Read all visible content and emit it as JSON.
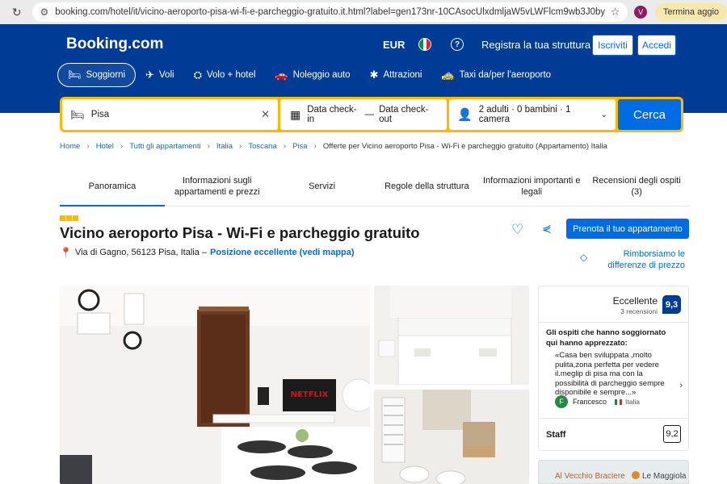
{
  "browser": {
    "url": "booking.com/hotel/it/vicino-aeroporto-pisa-wi-fi-e-parcheggio-gratuito.it.html?label=gen173nr-10CAsocUlxdmljaW5vLWFlcm9wb3J0by1waXNhLXdp",
    "profile_initial": "V",
    "update_label": "Termina aggio"
  },
  "header": {
    "logo": "Booking.com",
    "currency": "EUR",
    "register_label": "Registra la tua struttura",
    "signup_label": "Iscriviti",
    "login_label": "Accedi",
    "nav": [
      {
        "label": "Soggiorni",
        "icon": "bed-icon",
        "active": true
      },
      {
        "label": "Voli",
        "icon": "plane-icon"
      },
      {
        "label": "Volo + hotel",
        "icon": "flight-hotel-icon"
      },
      {
        "label": "Noleggio auto",
        "icon": "car-icon"
      },
      {
        "label": "Attrazioni",
        "icon": "attractions-icon"
      },
      {
        "label": "Taxi da/per l'aeroporto",
        "icon": "taxi-icon"
      }
    ]
  },
  "search": {
    "destination": "Pisa",
    "checkin": "Data check-in",
    "dash": "—",
    "checkout": "Data check-out",
    "guests": "2 adulti · 0 bambini · 1 camera",
    "submit_label": "Cerca"
  },
  "breadcrumb": {
    "items": [
      "Home",
      "Hotel",
      "Tutti gli appartamenti",
      "Italia",
      "Toscana",
      "Pisa"
    ],
    "current": "Offerte per Vicino aeroporto Pisa - Wi-Fi e parcheggio gratuito (Appartamento) Italia",
    "separator": "›"
  },
  "tabs": [
    "Panoramica",
    "Informazioni sugli appartamenti e prezzi",
    "Servizi",
    "Regole della struttura",
    "Informazioni importanti e legali",
    "Recensioni degli ospiti (3)"
  ],
  "property": {
    "title": "Vicino aeroporto Pisa - Wi-Fi e parcheggio gratuito",
    "address": "Via di Gagno, 56123 Pisa, Italia –",
    "location_link": "Posizione eccellente (vedi mappa)",
    "book_label": "Prenota il tuo appartamento",
    "refund_label": "Rimborsiamo le differenze di prezzo",
    "tv_brand": "NETFLIX"
  },
  "reviews": {
    "rating_word": "Eccellente",
    "count": "3 recensioni",
    "score": "9,3",
    "liked_heading": "Gli ospiti che hanno soggiornato qui hanno apprezzato:",
    "quote": "«Casa ben sviluppata ,molto pulita,zona perfetta per vedere il.meglip di pisa ma con la possibilità di parcheggio sempre disponibile e sempre...»",
    "reviewer_initial": "F",
    "reviewer": "Francesco",
    "country": "Italia",
    "staff_label": "Staff",
    "staff_score": "9,2"
  },
  "map": {
    "label_1": "Al Vecchio Braciere",
    "label_2": "Le Maggiola"
  },
  "colors": {
    "brand_blue": "#003b95",
    "accent": "#006ce4",
    "search_border": "#ffb700"
  }
}
